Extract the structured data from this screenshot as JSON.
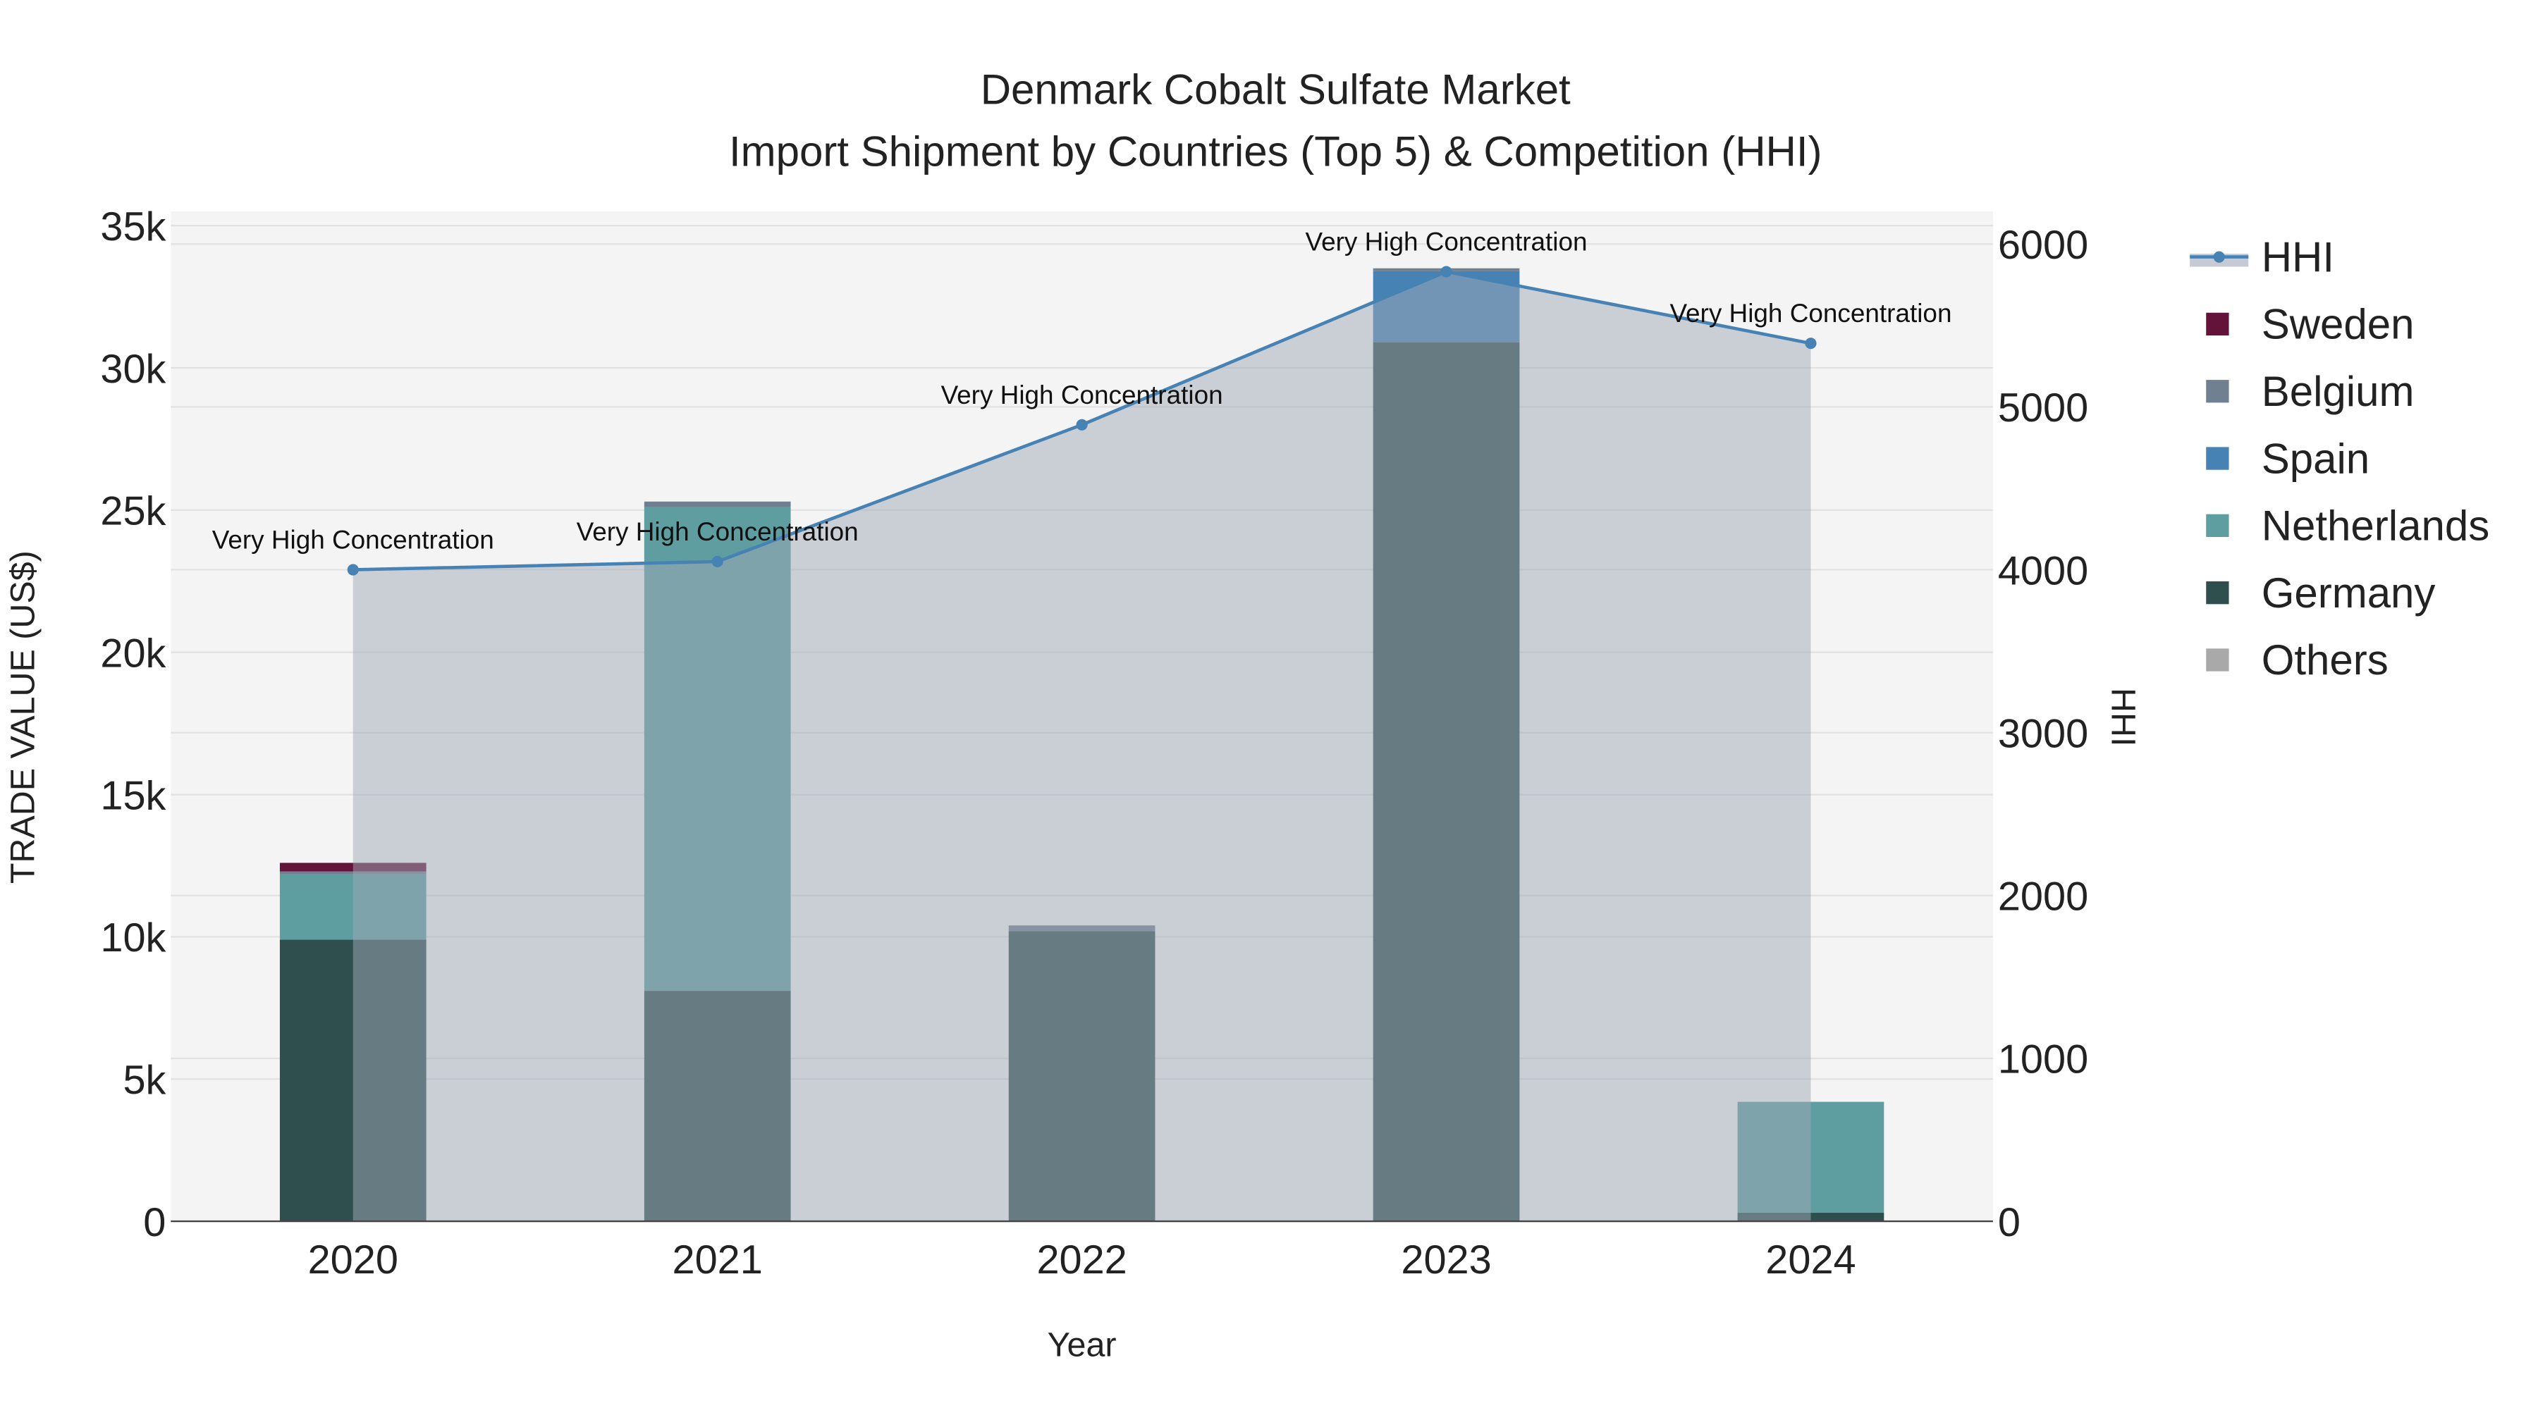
{
  "chart_data": {
    "type": "bar",
    "title": "Denmark Cobalt Sulfate Market",
    "subtitle": "Import Shipment by Countries (Top 5) & Competition (HHI)",
    "xlabel": "Year",
    "ylabel": "TRADE VALUE (US$)",
    "y2label": "HHI",
    "categories": [
      "2020",
      "2021",
      "2022",
      "2023",
      "2024"
    ],
    "ylim": [
      0,
      35500
    ],
    "y2lim": [
      0,
      6200
    ],
    "yticks": [
      0,
      5000,
      10000,
      15000,
      20000,
      25000,
      30000,
      35000
    ],
    "ytick_labels": [
      "0",
      "5k",
      "10k",
      "15k",
      "20k",
      "25k",
      "30k",
      "35k"
    ],
    "y2ticks": [
      0,
      1000,
      2000,
      3000,
      4000,
      5000,
      6000
    ],
    "y2tick_labels": [
      "0",
      "1000",
      "2000",
      "3000",
      "4000",
      "5000",
      "6000"
    ],
    "stacked": true,
    "grid": true,
    "legend_placement": "right",
    "series": [
      {
        "name": "Germany",
        "color": "#2f4f4f",
        "values": [
          9900,
          8100,
          10200,
          30900,
          300
        ]
      },
      {
        "name": "Netherlands",
        "color": "#5f9ea0",
        "values": [
          2300,
          17000,
          0,
          0,
          3900
        ]
      },
      {
        "name": "Spain",
        "color": "#4682b4",
        "values": [
          0,
          0,
          0,
          2500,
          0
        ]
      },
      {
        "name": "Belgium",
        "color": "#708090",
        "values": [
          100,
          200,
          200,
          100,
          0
        ]
      },
      {
        "name": "Sweden",
        "color": "#63133a",
        "values": [
          300,
          0,
          0,
          0,
          0
        ]
      },
      {
        "name": "Others",
        "color": "#a9a9a9",
        "values": [
          0,
          0,
          0,
          0,
          0
        ]
      }
    ],
    "legend_order": [
      "HHI",
      "Sweden",
      "Belgium",
      "Spain",
      "Netherlands",
      "Germany",
      "Others"
    ],
    "hhi": {
      "name": "HHI",
      "color": "#4682b4",
      "values": [
        4000,
        4050,
        4890,
        5830,
        5390
      ],
      "annotations": [
        "Very High Concentration",
        "Very High Concentration",
        "Very High Concentration",
        "Very High Concentration",
        "Very High Concentration"
      ]
    }
  }
}
